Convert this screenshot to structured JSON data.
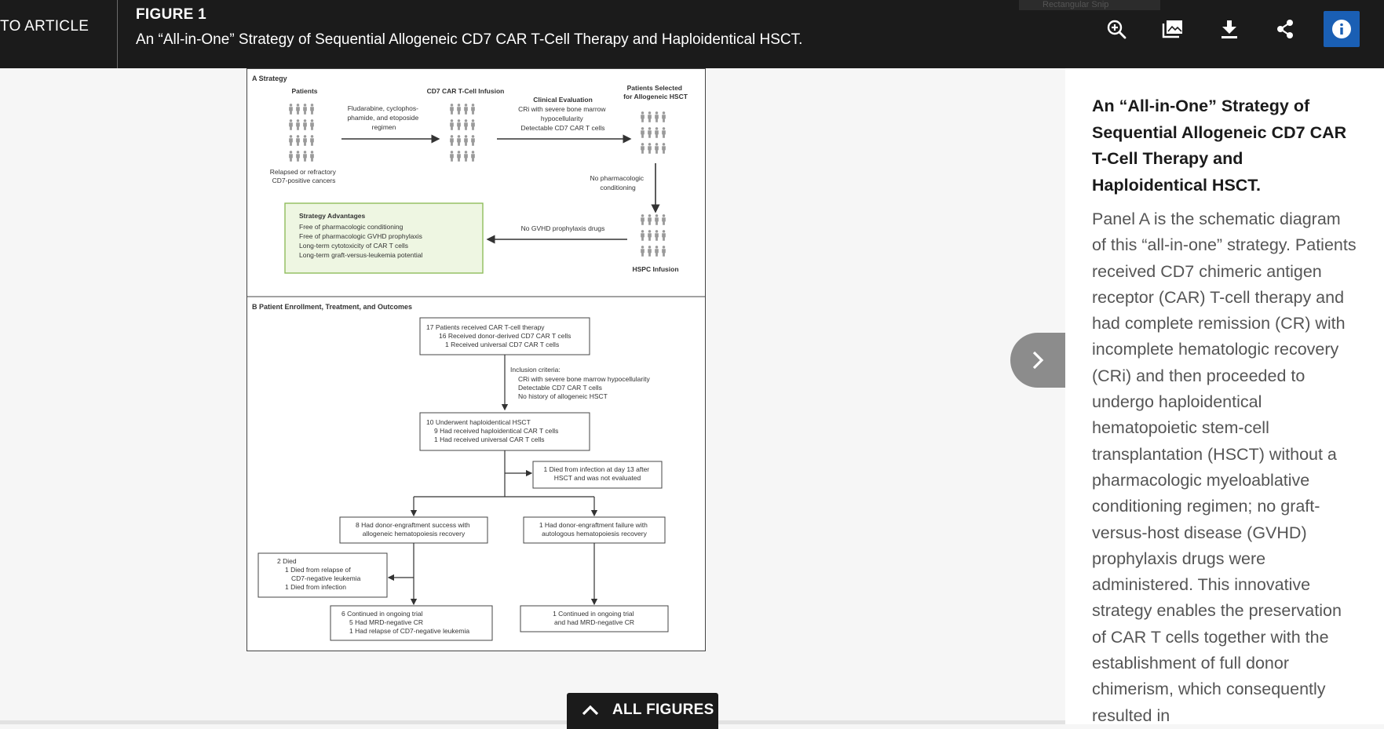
{
  "header": {
    "back_label": "TO ARTICLE",
    "figure_label": "FIGURE 1",
    "figure_title": "An “All-in-One” Strategy of Sequential Allogeneic CD7 CAR T-Cell Therapy and Haploidentical HSCT.",
    "faded_tooltip": "Rectangular Snip",
    "toolbar": [
      "zoom-in-icon",
      "gallery-icon",
      "download-icon",
      "share-icon",
      "info-icon"
    ],
    "accent_color": "#1a5fb4"
  },
  "figure": {
    "panel_a": {
      "heading": "A  Strategy",
      "patients_label": "Patients",
      "infusion_label": "CD7 CAR T-Cell Infusion",
      "selected_label": [
        "Patients Selected",
        "for Allogeneic HSCT"
      ],
      "regimen": [
        "Fludarabine, cyclophos-",
        "phamide, and etoposide",
        "regimen"
      ],
      "eval_title": "Clinical Evaluation",
      "eval_lines": [
        "CRi with severe bone marrow",
        "hypocellularity",
        "Detectable CD7 CAR T cells"
      ],
      "relapsed": [
        "Relapsed or refractory",
        "CD7-positive cancers"
      ],
      "no_conditioning": [
        "No pharmacologic",
        "conditioning"
      ],
      "advantages_title": "Strategy Advantages",
      "advantages": [
        "Free of pharmacologic conditioning",
        "Free of pharmacologic GVHD prophylaxis",
        "Long-term cytotoxicity of CAR T cells",
        "Long-term graft-versus-leukemia potential"
      ],
      "no_gvhd": "No GVHD prophylaxis drugs",
      "hspc": "HSPC Infusion"
    },
    "panel_b": {
      "heading": "B  Patient Enrollment, Treatment, and Outcomes",
      "box1": [
        "17 Patients received CAR T-cell therapy",
        "16 Received donor-derived CD7 CAR T cells",
        "1 Received universal CD7 CAR T cells"
      ],
      "inclusion": [
        "Inclusion criteria:",
        "CRi with severe bone marrow hypocellularity",
        "Detectable CD7 CAR T cells",
        "No history of allogeneic HSCT"
      ],
      "box2": [
        "10 Underwent haploidentical HSCT",
        "9 Had received haploidentical CAR T cells",
        "1 Had received universal CAR T cells"
      ],
      "died_box": [
        "1 Died from infection at day 13 after",
        "HSCT and was not evaluated"
      ],
      "success_box": [
        "8 Had donor-engraftment success with",
        "allogeneic hematopoiesis recovery"
      ],
      "failure_box": [
        "1 Had donor-engraftment failure with",
        "autologous hematopoiesis recovery"
      ],
      "two_died": [
        "2 Died",
        "1 Died from relapse of",
        "CD7-negative leukemia",
        "1 Died from infection"
      ],
      "continued_six": [
        "6 Continued in ongoing trial",
        "5 Had MRD-negative CR",
        "1 Had relapse of CD7-negative leukemia"
      ],
      "continued_one": [
        "1 Continued in ongoing trial",
        "and had MRD-negative CR"
      ]
    }
  },
  "side_panel": {
    "title": "An “All-in-One” Strategy of Sequential Allogeneic CD7 CAR T-Cell Therapy and Haploidentical HSCT.",
    "description": "Panel A is the schematic diagram of this “all-in-one” strategy. Patients received CD7 chimeric antigen receptor (CAR) T-cell therapy and had complete remission (CR) with incomplete hematologic recovery (CRi) and then proceeded to undergo haploidentical hematopoietic stem-cell transplantation (HSCT) without a pharmacologic myeloablative conditioning regimen; no graft-versus-host disease (GVHD) prophylaxis drugs were administered. This innovative strategy enables the preservation of CAR T cells together with the establishment of full donor chimerism, which consequently resulted in"
  },
  "footer": {
    "all_figures_label": "ALL FIGURES"
  }
}
